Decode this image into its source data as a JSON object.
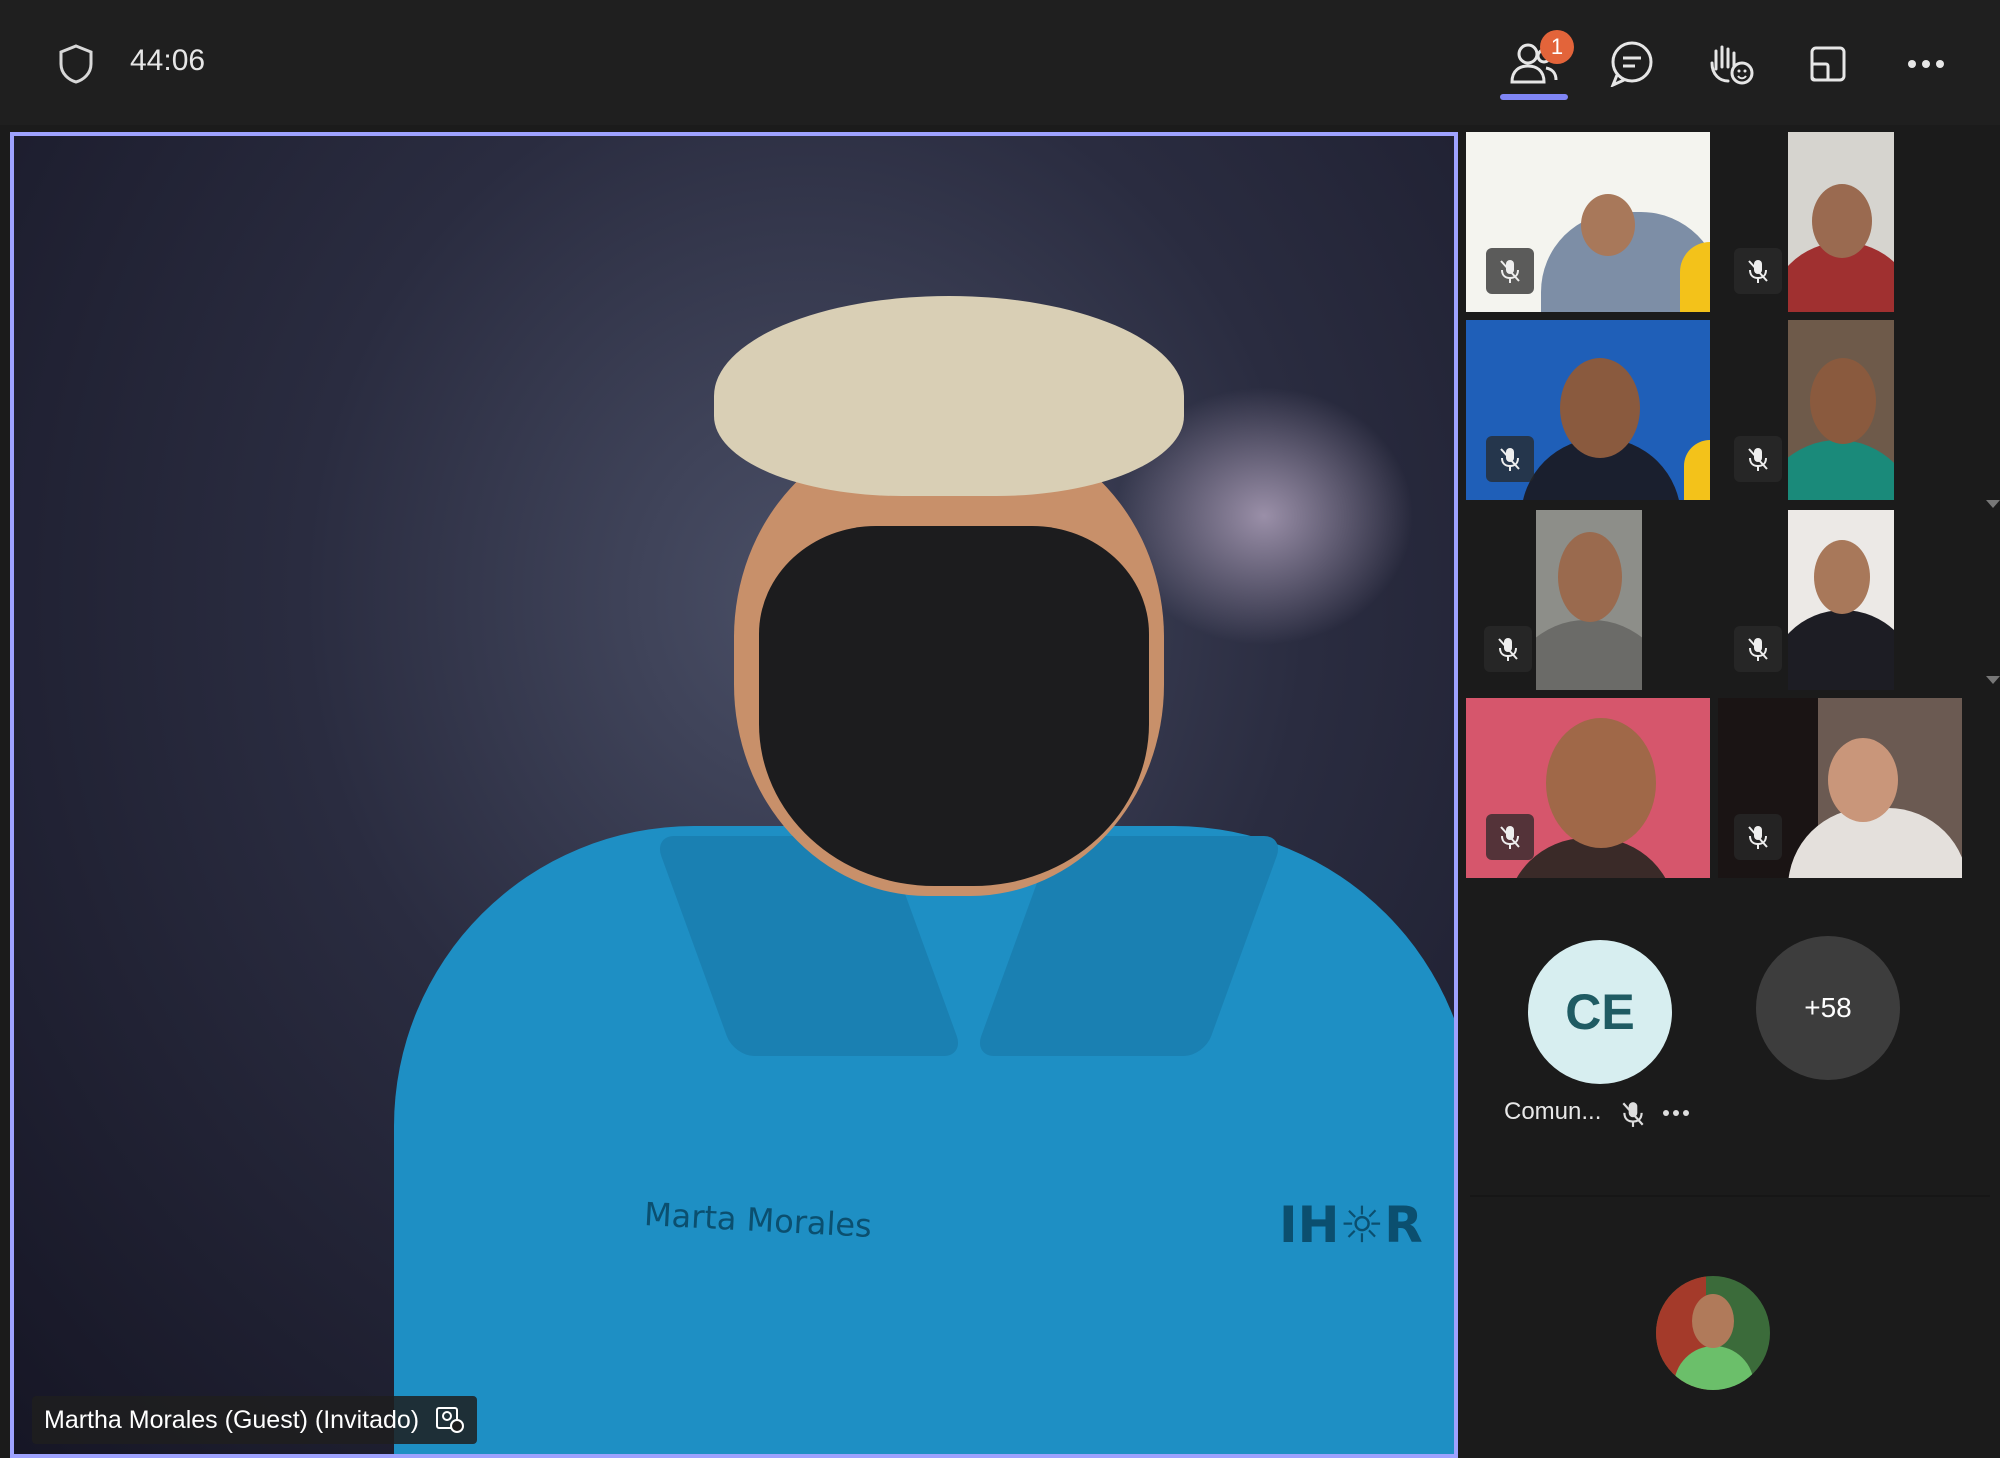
{
  "topbar": {
    "timer": "44:06",
    "participants_badge": "1",
    "icons": [
      "shield-icon",
      "people-icon",
      "chat-icon",
      "react-icon",
      "view-icon",
      "more-icon"
    ]
  },
  "main": {
    "name_tag": "Martha Morales (Guest) (Invitado)",
    "shirt_name": "Marta Morales",
    "shirt_logo": "IH☼R"
  },
  "participants": {
    "ce_initials": "CE",
    "ce_name": "Comun...",
    "more_count": "+58"
  },
  "colors": {
    "accent": "#9ea2ff",
    "badge": "#e3643a",
    "background": "#1b1b1b"
  }
}
